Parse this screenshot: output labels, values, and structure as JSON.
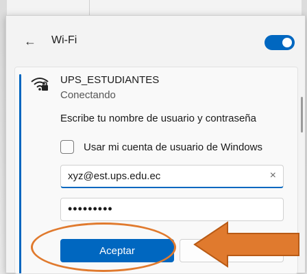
{
  "header": {
    "back_icon": "arrow-left-icon",
    "title": "Wi-Fi",
    "wifi_enabled": true
  },
  "network": {
    "icon": "wifi-locked-icon",
    "name": "UPS_ESTUDIANTES",
    "status": "Conectando",
    "prompt": "Escribe tu nombre de usuario y contraseña",
    "use_windows_account_label": "Usar mi cuenta de usuario de Windows",
    "use_windows_account_checked": false,
    "username_value": "xyz@est.ups.edu.ec",
    "clear_icon": "×",
    "password_value": "•••••••••",
    "accept_label": "Aceptar",
    "cancel_label": ""
  },
  "annotation": {
    "highlight_color": "#e07a2e",
    "arrow_color": "#e07a2e"
  },
  "colors": {
    "accent": "#0067c0"
  }
}
